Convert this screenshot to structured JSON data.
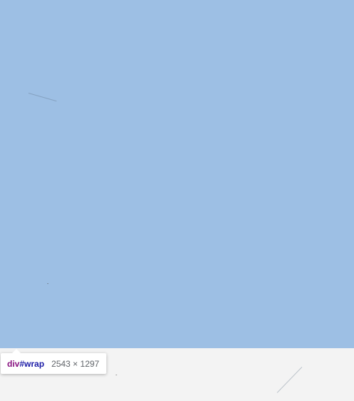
{
  "overlay": {
    "highlight_color": "#9dbfe4",
    "background_color": "#f3f3f3"
  },
  "tooltip": {
    "tag_name": "div",
    "element_id": "#wrap",
    "dimensions": "2543 × 1297"
  }
}
